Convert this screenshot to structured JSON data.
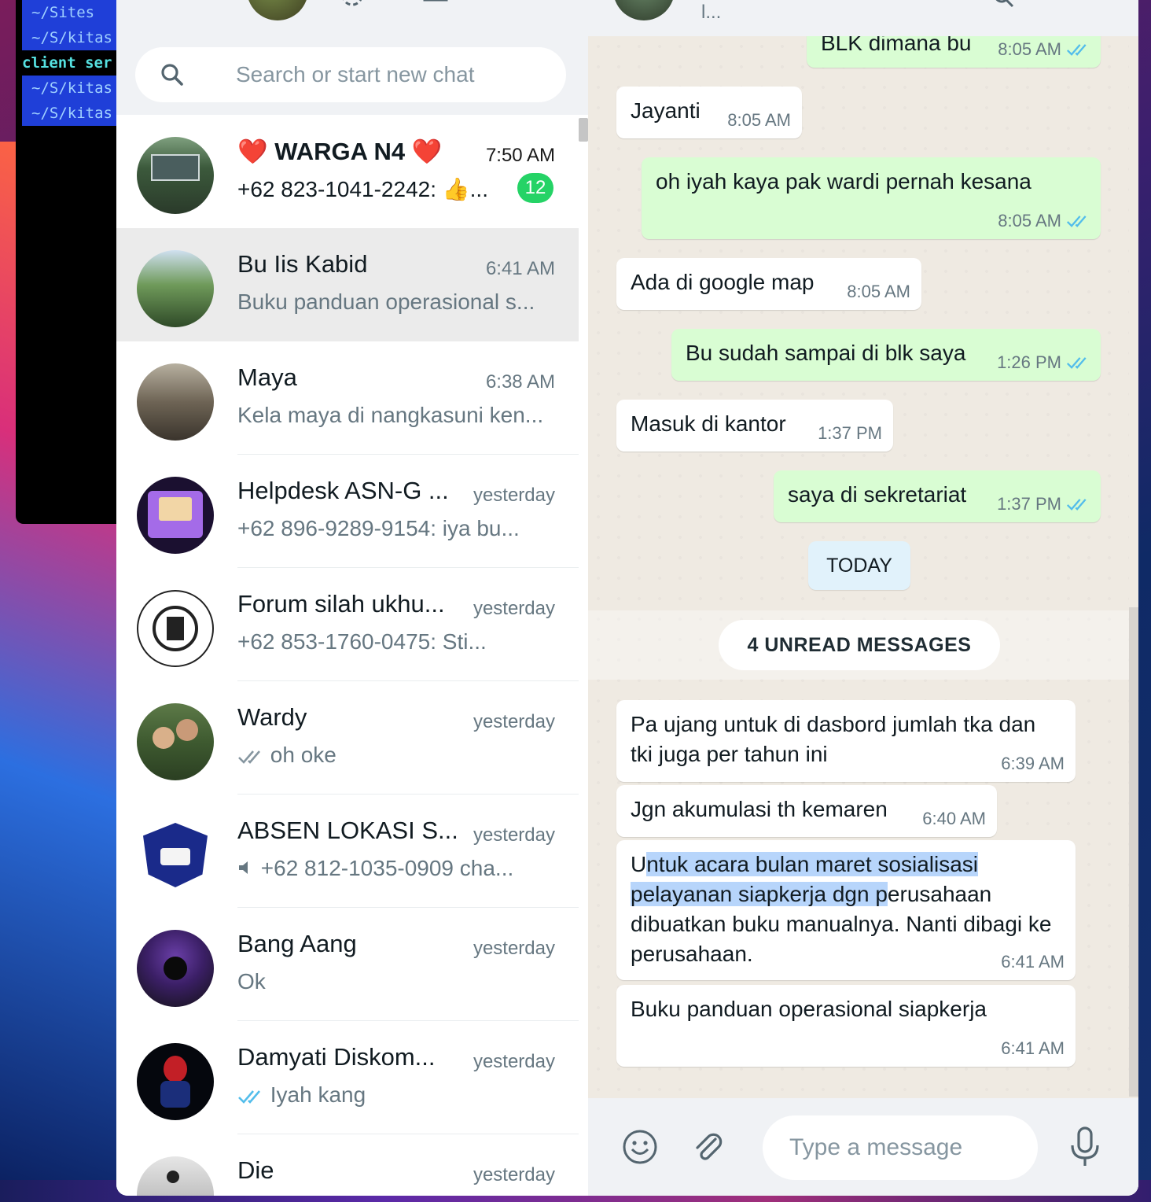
{
  "terminal": {
    "lines": [
      "~/Sites",
      "~/S/kitas",
      "client ser",
      "~/S/kitas",
      "~/S/kitas"
    ]
  },
  "sidebar": {
    "search_placeholder": "Search or start new chat",
    "chats": [
      {
        "name": "WARGA  N4",
        "time": "7:50 AM",
        "preview": "+62 823-1041-2242: 👍...",
        "badge": "12"
      },
      {
        "name": "Bu Iis Kabid",
        "time": "6:41 AM",
        "preview": "Buku panduan operasional s..."
      },
      {
        "name": "Maya",
        "time": "6:38 AM",
        "preview": "Kela maya di nangkasuni ken..."
      },
      {
        "name": "Helpdesk ASN-G ...",
        "time": "yesterday",
        "preview": "+62 896-9289-9154: iya bu..."
      },
      {
        "name": "Forum silah ukhu...",
        "time": "yesterday",
        "preview": "+62 853-1760-0475:  Sti..."
      },
      {
        "name": "Wardy",
        "time": "yesterday",
        "preview": "oh oke"
      },
      {
        "name": "ABSEN LOKASI S...",
        "time": "yesterday",
        "preview": "+62 812-1035-0909 cha..."
      },
      {
        "name": "Bang Aang",
        "time": "yesterday",
        "preview": "Ok"
      },
      {
        "name": "Damyati Diskom...",
        "time": "yesterday",
        "preview": "Iyah kang"
      },
      {
        "name": "Die",
        "time": "yesterday",
        "preview": ""
      }
    ]
  },
  "conversation": {
    "header_status": "l...",
    "messages": [
      {
        "dir": "out",
        "text": "BLK dimana bu",
        "time": "8:05 AM"
      },
      {
        "dir": "in",
        "text": "Jayanti",
        "time": "8:05 AM"
      },
      {
        "dir": "out",
        "text": "oh iyah kaya pak wardi pernah kesana",
        "time": "8:05 AM"
      },
      {
        "dir": "in",
        "text": "Ada di google map",
        "time": "8:05 AM"
      },
      {
        "dir": "out",
        "text": "Bu sudah sampai di blk saya",
        "time": "1:26 PM"
      },
      {
        "dir": "in",
        "text": "Masuk di kantor",
        "time": "1:37 PM"
      },
      {
        "dir": "out",
        "text": "saya di sekretariat",
        "time": "1:37 PM"
      },
      {
        "dir": "in",
        "text": "Pa ujang untuk di dasbord jumlah tka dan tki juga per tahun ini",
        "time": "6:39 AM"
      },
      {
        "dir": "in",
        "text": "Jgn akumulasi th kemaren",
        "time": "6:40 AM"
      },
      {
        "dir": "in",
        "text_pre": "U",
        "text_sel_1": "ntuk acara bulan maret sosialisasi ",
        "text_sel_2": "pelayanan siapkerja dgn p",
        "text_post": "erusahaan dibuatkan buku manualnya. Nanti dibagi ke perusahaan.",
        "time": "6:41 AM"
      },
      {
        "dir": "in",
        "text": "Buku panduan operasional siapkerja",
        "time": "6:41 AM"
      }
    ],
    "day_divider": "TODAY",
    "unread_divider": "4 UNREAD MESSAGES"
  },
  "composer": {
    "placeholder": "Type a message"
  },
  "colors": {
    "accent_green": "#25d366",
    "outgoing_bubble": "#d9fdd3",
    "read_tick": "#53bdeb"
  }
}
